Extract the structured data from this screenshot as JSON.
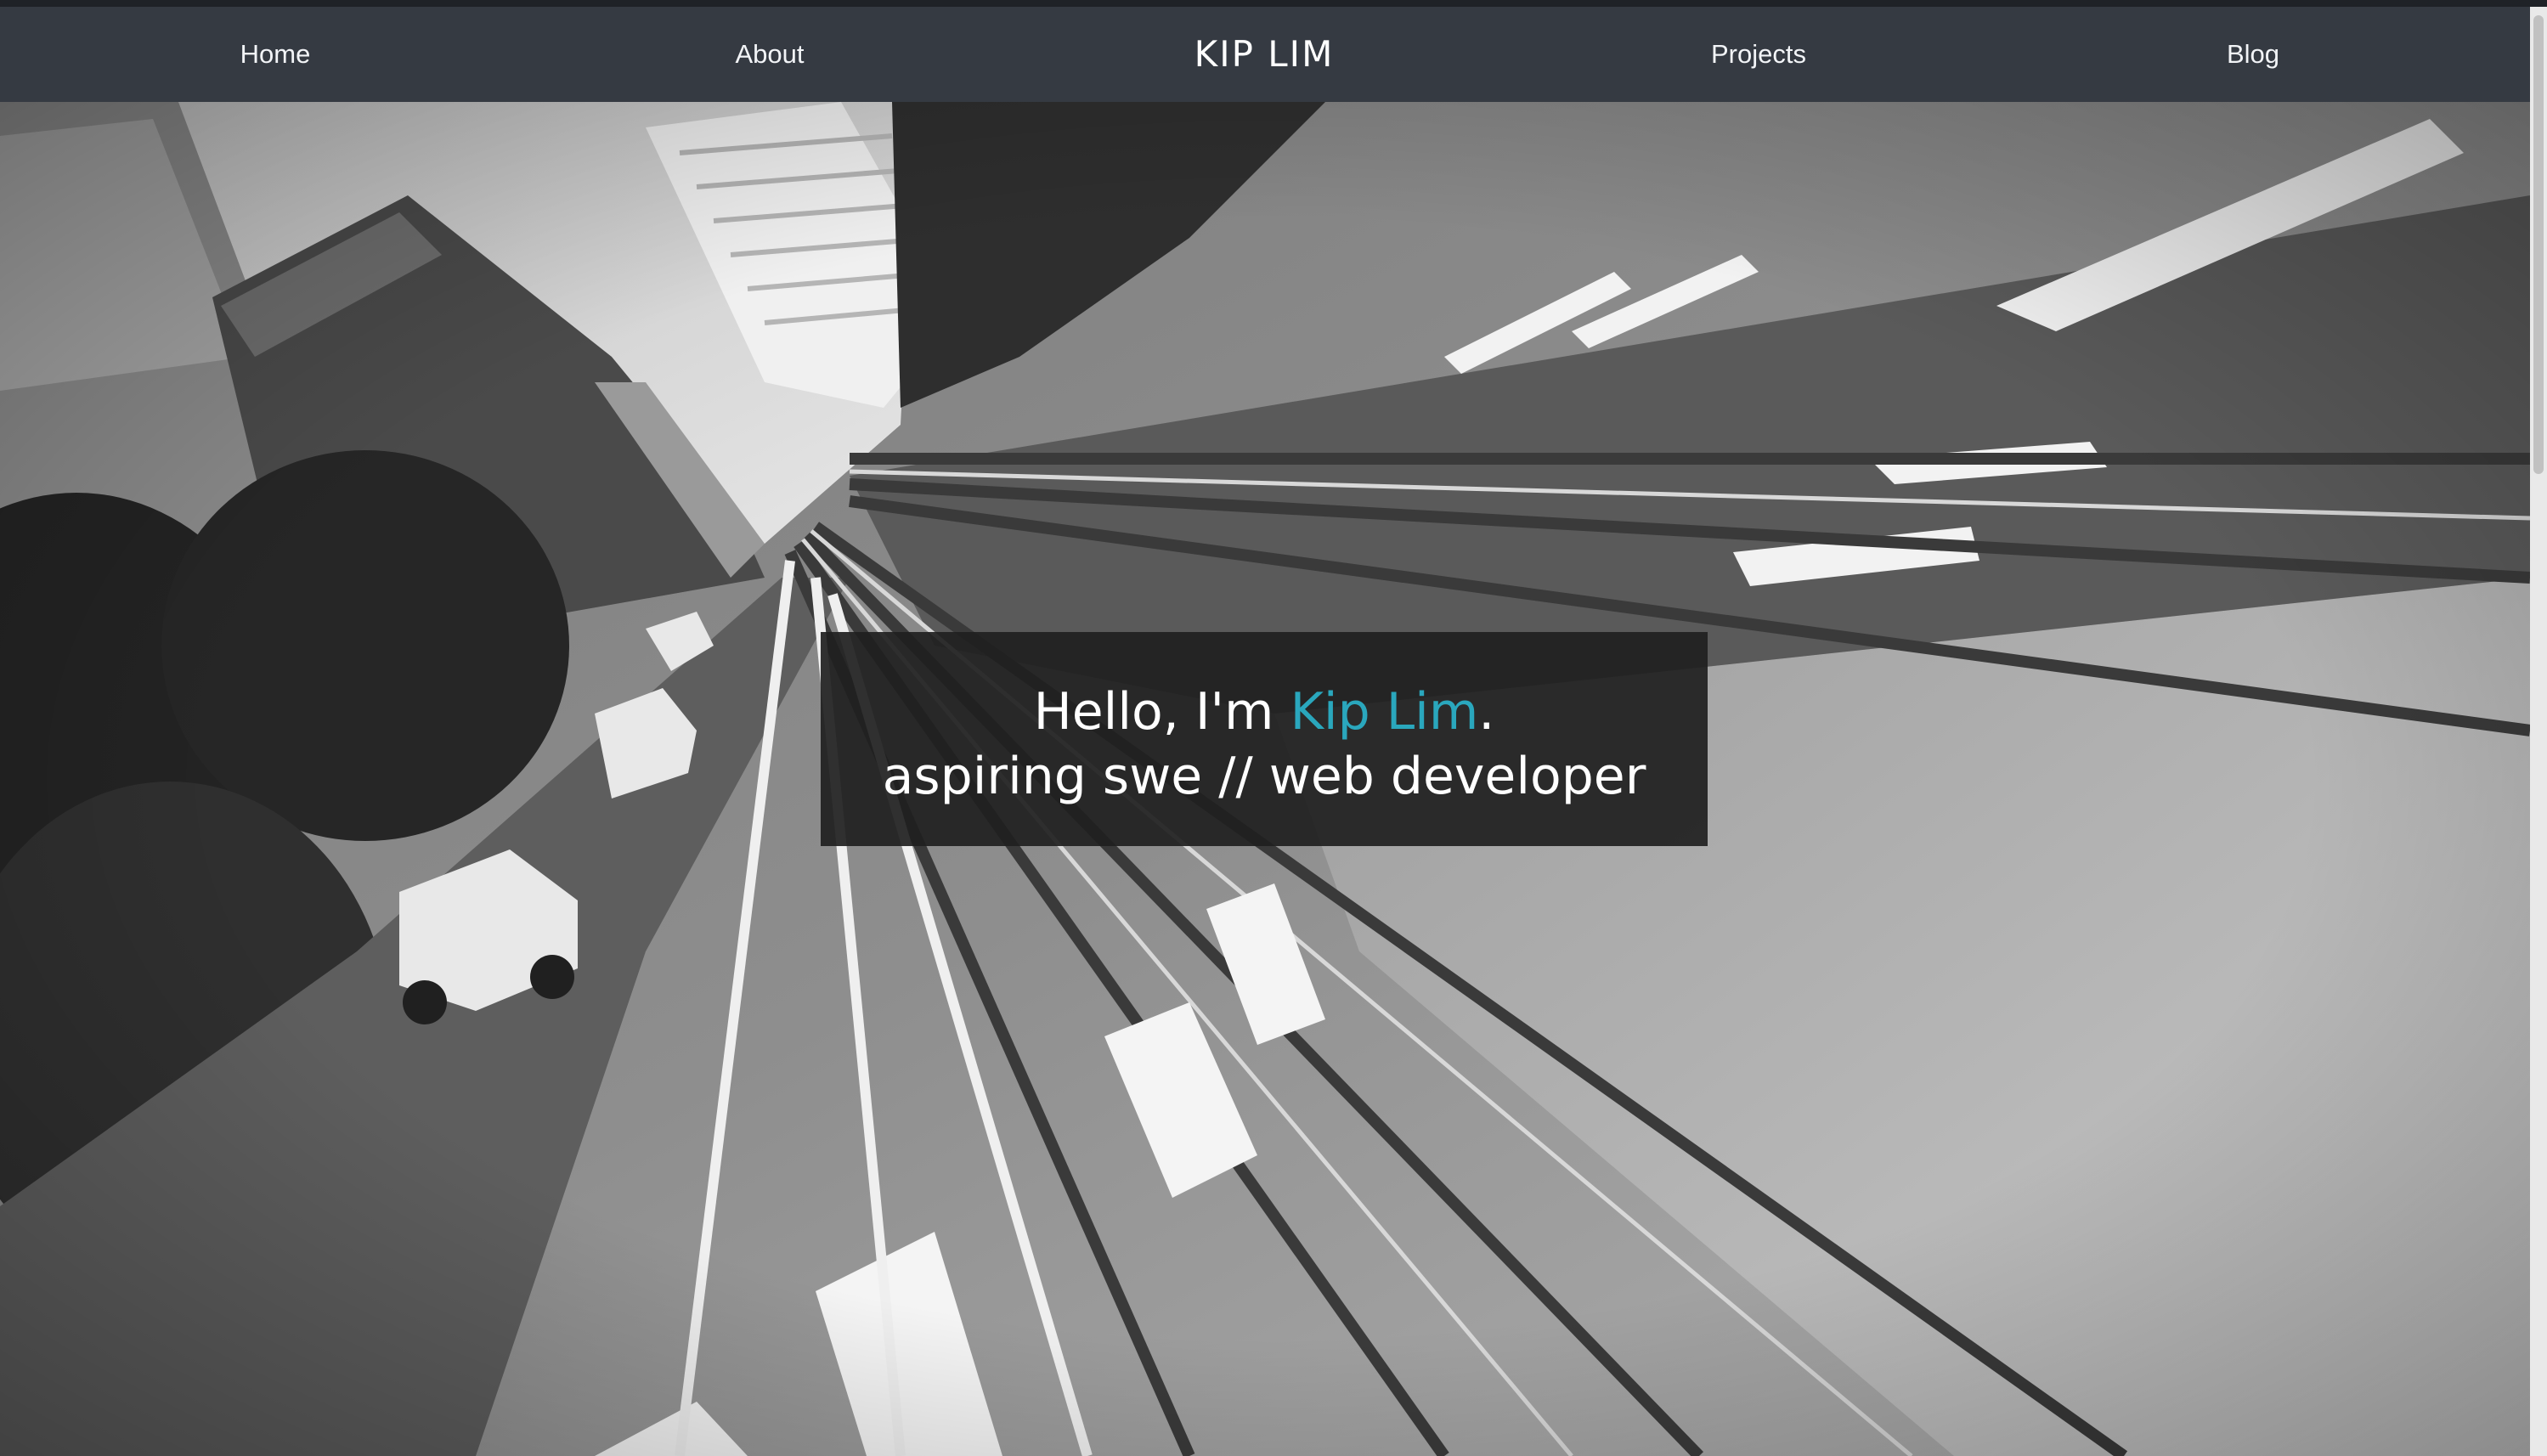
{
  "nav": {
    "home": "Home",
    "about": "About",
    "brand": "KIP LIM",
    "projects": "Projects",
    "blog": "Blog"
  },
  "hero": {
    "greeting_prefix": "Hello, I'm ",
    "name": "Kip Lim",
    "greeting_suffix": ".",
    "tagline": "aspiring swe // web developer"
  },
  "colors": {
    "navbar": "#353a42",
    "accent": "#2aa7bd",
    "intro_box": "#202020"
  }
}
